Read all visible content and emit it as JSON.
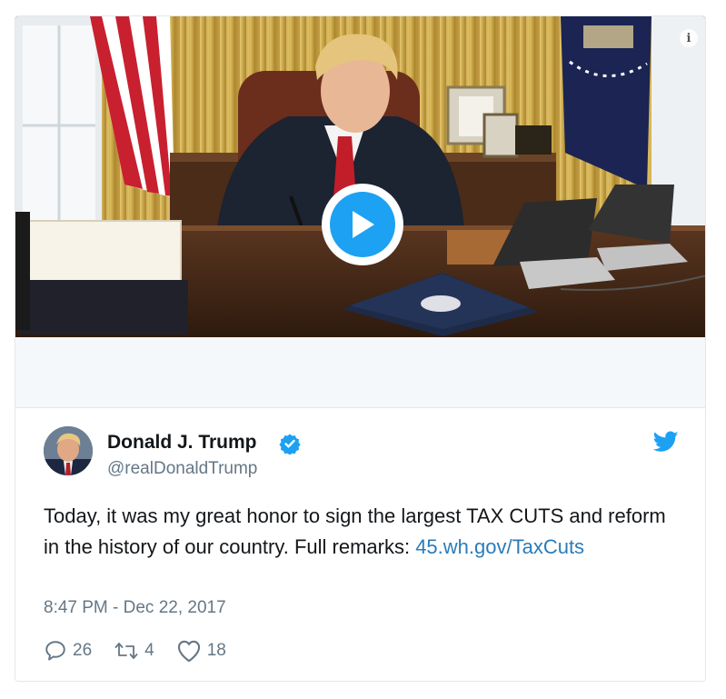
{
  "media": {
    "type": "video",
    "icons": {
      "info": "info-icon",
      "play": "play-icon"
    },
    "info_glyph": "i"
  },
  "tweet": {
    "author_name": "Donald J. Trump",
    "handle": "@realDonaldTrump",
    "verified": true,
    "text": "Today, it was my great honor to sign the largest TAX CUTS and reform in the history of our country. Full remarks: ",
    "link_text": "45.wh.gov/TaxCuts",
    "timestamp": "8:47 PM - Dec 22, 2017",
    "reply_count": "26",
    "retweet_count": "4",
    "like_count": "18"
  },
  "colors": {
    "accent": "#1da1f2",
    "link": "#2b7bb9",
    "secondary_text": "#657786",
    "border": "#e1e8ed"
  }
}
